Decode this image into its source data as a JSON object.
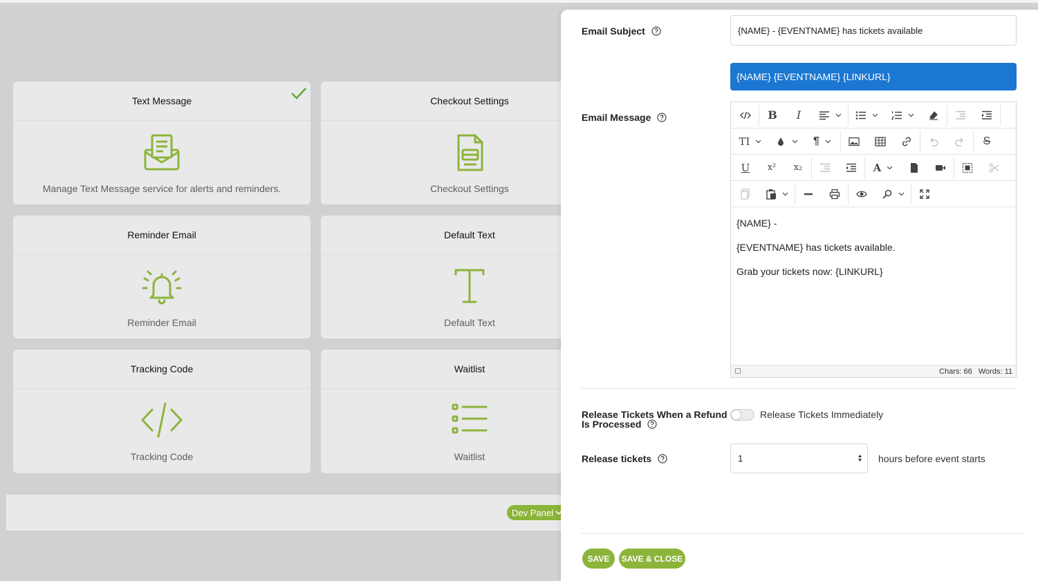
{
  "colors": {
    "accent": "#8cb43a",
    "tag_blue": "#1b77d2",
    "panel_bg": "#ffffff",
    "page_bg": "#d1d1d3"
  },
  "cards": [
    {
      "title": "Text Message",
      "description": "Manage Text Message service for alerts and reminders.",
      "icon": "envelope-icon",
      "checked": true
    },
    {
      "title": "Checkout Settings",
      "description": "Checkout Settings",
      "icon": "checkout-icon"
    },
    {
      "title": "Reminder Email",
      "description": "Reminder Email",
      "icon": "bell-icon"
    },
    {
      "title": "Default Text",
      "description": "Default Text",
      "icon": "text-icon"
    },
    {
      "title": "Tracking Code",
      "description": "Tracking Code",
      "icon": "code-icon"
    },
    {
      "title": "Waitlist",
      "description": "Waitlist",
      "icon": "list-icon"
    }
  ],
  "dev_panel": {
    "label": "Dev Panel"
  },
  "panel": {
    "email_subject": {
      "label": "Email Subject",
      "value": "{NAME} - {EVENTNAME} has tickets available"
    },
    "tags_bar": "{NAME} {EVENTNAME} {LINKURL}",
    "email_message": {
      "label": "Email Message",
      "content": [
        "{NAME} -",
        "{EVENTNAME} has tickets available.",
        "Grab your tickets now: {LINKURL}"
      ],
      "status": "Chars: 66   Words: 11"
    },
    "release_refund": {
      "label_line1": "Release Tickets When a Refund",
      "label_line2": "Is Processed",
      "toggle_label": "Release Tickets Immediately",
      "toggle_on": false
    },
    "release_tickets": {
      "label": "Release tickets",
      "value": "1",
      "suffix": "hours before event starts"
    },
    "buttons": {
      "save": "SAVE",
      "save_close": "SAVE & CLOSE"
    }
  }
}
